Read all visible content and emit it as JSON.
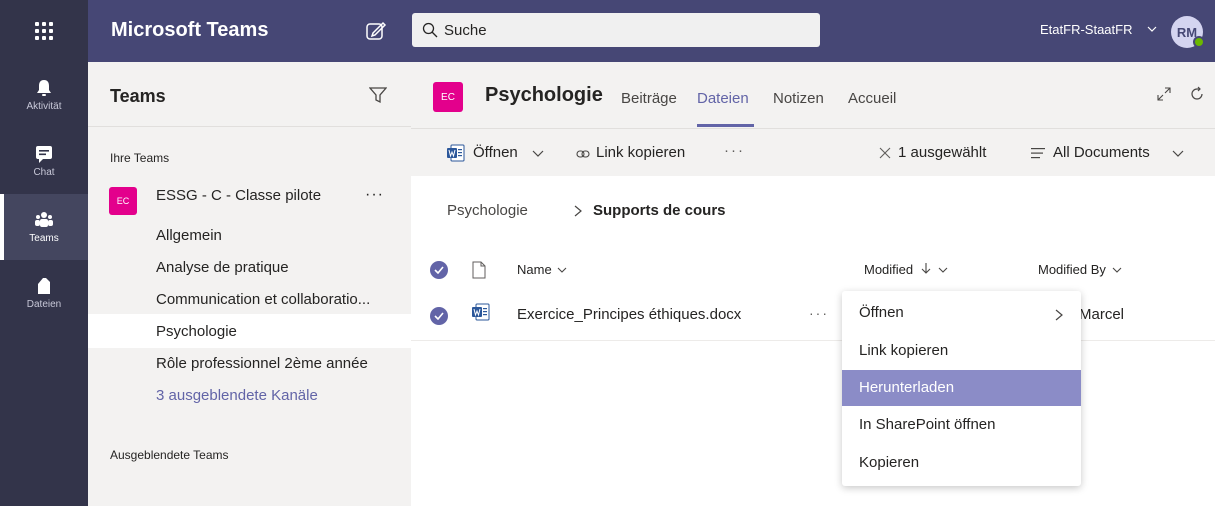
{
  "topbar": {
    "app_title": "Microsoft Teams",
    "search_placeholder": "Suche",
    "tenant": "EtatFR-StaatFR",
    "avatar_initials": "RM"
  },
  "rail": {
    "items": [
      {
        "label": "Aktivität",
        "icon": "bell-icon"
      },
      {
        "label": "Chat",
        "icon": "chat-icon"
      },
      {
        "label": "Teams",
        "icon": "teams-icon",
        "active": true
      },
      {
        "label": "Dateien",
        "icon": "file-icon"
      }
    ]
  },
  "teams_panel": {
    "title": "Teams",
    "section_your_teams": "Ihre Teams",
    "team": {
      "avatar": "EC",
      "name": "ESSG - C - Classe pilote",
      "more": "···"
    },
    "channels": [
      "Allgemein",
      "Analyse de pratique",
      "Communication et collaboratio...",
      "Psychologie",
      "Rôle professionnel 2ème année"
    ],
    "hidden_channels": "3 ausgeblendete Kanäle",
    "section_hidden_teams": "Ausgeblendete Teams"
  },
  "channel_header": {
    "avatar": "EC",
    "title": "Psychologie",
    "tabs": [
      "Beiträge",
      "Dateien",
      "Notizen",
      "Accueil"
    ],
    "active_tab": "Dateien"
  },
  "toolbar": {
    "open": "Öffnen",
    "copy_link": "Link kopieren",
    "more": "···",
    "selected": "1 ausgewählt",
    "view": "All Documents"
  },
  "breadcrumb": {
    "parent": "Psychologie",
    "current": "Supports de cours"
  },
  "table": {
    "columns": {
      "name": "Name",
      "modified": "Modified",
      "modified_by": "Modified By"
    },
    "rows": [
      {
        "name": "Exercice_Principes éthiques.docx",
        "more": "···",
        "modified_by": "Marcel"
      }
    ]
  },
  "context_menu": {
    "items": [
      "Öffnen",
      "Link kopieren",
      "Herunterladen",
      "In SharePoint öffnen",
      "Kopieren"
    ],
    "highlighted": "Herunterladen"
  },
  "colors": {
    "topbar": "#464775",
    "rail": "#33344a",
    "accent": "#6264a7",
    "team_avatar": "#e3008c",
    "menu_highlight": "#8b8cc7"
  }
}
